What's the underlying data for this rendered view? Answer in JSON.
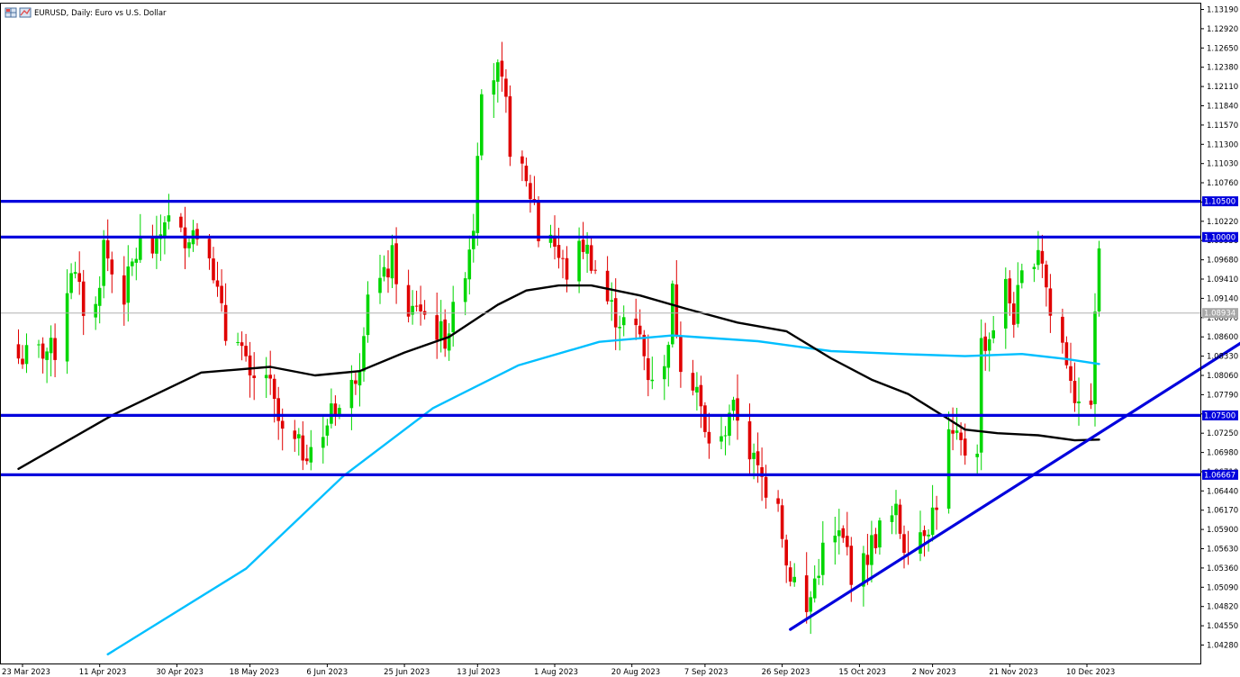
{
  "window": {
    "title": "EURUSD, Daily:  Euro vs U.S. Dollar",
    "icons": [
      "grid-icon",
      "chart-icon"
    ]
  },
  "chart_data": {
    "type": "candlestick",
    "symbol": "EURUSD",
    "timeframe": "Daily",
    "description": "Euro vs U.S. Dollar",
    "ylim": [
      1.0415,
      1.1325
    ],
    "y_ticks": [
      "1.13190",
      "1.12920",
      "1.12650",
      "1.12380",
      "1.12110",
      "1.11840",
      "1.11570",
      "1.11300",
      "1.11030",
      "1.10760",
      "1.10490",
      "1.10220",
      "1.09950",
      "1.09680",
      "1.09410",
      "1.09140",
      "1.08870",
      "1.08600",
      "1.08330",
      "1.08060",
      "1.07790",
      "1.07520",
      "1.07250",
      "1.06980",
      "1.06710",
      "1.06440",
      "1.06170",
      "1.05900",
      "1.05630",
      "1.05360",
      "1.05090",
      "1.04820",
      "1.04550",
      "1.04280"
    ],
    "x_ticks": [
      {
        "label": "23 Mar 2023",
        "date": "2023-03-23"
      },
      {
        "label": "11 Apr 2023",
        "date": "2023-04-11"
      },
      {
        "label": "30 Apr 2023",
        "date": "2023-04-30"
      },
      {
        "label": "18 May 2023",
        "date": "2023-05-18"
      },
      {
        "label": "6 Jun 2023",
        "date": "2023-06-06"
      },
      {
        "label": "25 Jun 2023",
        "date": "2023-06-25"
      },
      {
        "label": "13 Jul 2023",
        "date": "2023-07-13"
      },
      {
        "label": "1 Aug 2023",
        "date": "2023-08-01"
      },
      {
        "label": "20 Aug 2023",
        "date": "2023-08-20"
      },
      {
        "label": "7 Sep 2023",
        "date": "2023-09-07"
      },
      {
        "label": "26 Sep 2023",
        "date": "2023-09-26"
      },
      {
        "label": "15 Oct 2023",
        "date": "2023-10-15"
      },
      {
        "label": "2 Nov 2023",
        "date": "2023-11-02"
      },
      {
        "label": "21 Nov 2023",
        "date": "2023-11-21"
      },
      {
        "label": "10 Dec 2023",
        "date": "2023-12-10"
      }
    ],
    "date_range": [
      "2023-03-22",
      "2023-12-13"
    ],
    "close_path": [
      [
        "2023-03-22",
        1.083
      ],
      [
        "2023-03-28",
        1.084
      ],
      [
        "2023-03-31",
        1.084
      ],
      [
        "2023-04-04",
        1.096
      ],
      [
        "2023-04-07",
        1.09
      ],
      [
        "2023-04-10",
        1.09
      ],
      [
        "2023-04-12",
        1.099
      ],
      [
        "2023-04-14",
        1.095
      ],
      [
        "2023-04-17",
        1.092
      ],
      [
        "2023-04-19",
        1.096
      ],
      [
        "2023-04-21",
        1.099
      ],
      [
        "2023-04-25",
        1.098
      ],
      [
        "2023-04-27",
        1.103
      ],
      [
        "2023-05-01",
        1.1
      ],
      [
        "2023-05-04",
        1.101
      ],
      [
        "2023-05-08",
        1.099
      ],
      [
        "2023-05-10",
        1.092
      ],
      [
        "2023-05-12",
        1.086
      ],
      [
        "2023-05-15",
        1.087
      ],
      [
        "2023-05-18",
        1.079
      ],
      [
        "2023-05-22",
        1.081
      ],
      [
        "2023-05-24",
        1.076
      ],
      [
        "2023-05-26",
        1.072
      ],
      [
        "2023-05-31",
        1.07
      ],
      [
        "2023-06-02",
        1.071
      ],
      [
        "2023-06-05",
        1.071
      ],
      [
        "2023-06-07",
        1.077
      ],
      [
        "2023-06-09",
        1.076
      ],
      [
        "2023-06-12",
        1.079
      ],
      [
        "2023-06-14",
        1.083
      ],
      [
        "2023-06-16",
        1.093
      ],
      [
        "2023-06-20",
        1.094
      ],
      [
        "2023-06-22",
        1.097
      ],
      [
        "2023-06-26",
        1.088
      ],
      [
        "2023-06-28",
        1.091
      ],
      [
        "2023-07-01",
        1.088
      ],
      [
        "2023-07-05",
        1.086
      ],
      [
        "2023-07-07",
        1.089
      ],
      [
        "2023-07-10",
        1.096
      ],
      [
        "2023-07-12",
        1.102
      ],
      [
        "2023-07-13",
        1.113
      ],
      [
        "2023-07-14",
        1.122
      ],
      [
        "2023-07-18",
        1.123
      ],
      [
        "2023-07-20",
        1.118
      ],
      [
        "2023-07-21",
        1.113
      ],
      [
        "2023-07-25",
        1.107
      ],
      [
        "2023-07-27",
        1.105
      ],
      [
        "2023-07-28",
        1.1
      ],
      [
        "2023-07-31",
        1.101
      ],
      [
        "2023-08-02",
        1.097
      ],
      [
        "2023-08-04",
        1.095
      ],
      [
        "2023-08-08",
        1.099
      ],
      [
        "2023-08-10",
        1.097
      ],
      [
        "2023-08-14",
        1.091
      ],
      [
        "2023-08-16",
        1.089
      ],
      [
        "2023-08-18",
        1.088
      ],
      [
        "2023-08-22",
        1.086
      ],
      [
        "2023-08-24",
        1.081
      ],
      [
        "2023-08-28",
        1.081
      ],
      [
        "2023-08-30",
        1.092
      ],
      [
        "2023-09-01",
        1.083
      ],
      [
        "2023-09-05",
        1.079
      ],
      [
        "2023-09-07",
        1.072
      ],
      [
        "2023-09-11",
        1.071
      ],
      [
        "2023-09-13",
        1.076
      ],
      [
        "2023-09-15",
        1.075
      ],
      [
        "2023-09-18",
        1.07
      ],
      [
        "2023-09-20",
        1.067
      ],
      [
        "2023-09-22",
        1.065
      ],
      [
        "2023-09-25",
        1.064
      ],
      [
        "2023-09-27",
        1.054
      ],
      [
        "2023-09-29",
        1.052
      ],
      [
        "2023-10-02",
        1.047
      ],
      [
        "2023-10-04",
        1.052
      ],
      [
        "2023-10-06",
        1.056
      ],
      [
        "2023-10-10",
        1.058
      ],
      [
        "2023-10-12",
        1.056
      ],
      [
        "2023-10-13",
        1.053
      ],
      [
        "2023-10-16",
        1.054
      ],
      [
        "2023-10-18",
        1.057
      ],
      [
        "2023-10-20",
        1.059
      ],
      [
        "2023-10-24",
        1.061
      ],
      [
        "2023-10-26",
        1.057
      ],
      [
        "2023-10-30",
        1.059
      ],
      [
        "2023-11-01",
        1.06
      ],
      [
        "2023-11-03",
        1.063
      ],
      [
        "2023-11-06",
        1.072
      ],
      [
        "2023-11-08",
        1.071
      ],
      [
        "2023-11-10",
        1.07
      ],
      [
        "2023-11-13",
        1.071
      ],
      [
        "2023-11-14",
        1.085
      ],
      [
        "2023-11-16",
        1.086
      ],
      [
        "2023-11-20",
        1.093
      ],
      [
        "2023-11-22",
        1.089
      ],
      [
        "2023-11-24",
        1.094
      ],
      [
        "2023-11-28",
        1.099
      ],
      [
        "2023-11-29",
        1.097
      ],
      [
        "2023-12-01",
        1.089
      ],
      [
        "2023-12-04",
        1.085
      ],
      [
        "2023-12-06",
        1.081
      ],
      [
        "2023-12-08",
        1.075
      ],
      [
        "2023-12-10",
        1.076
      ],
      [
        "2023-12-11",
        1.078
      ],
      [
        "2023-12-12",
        1.088
      ],
      [
        "2023-12-13",
        1.099
      ]
    ],
    "current_price": {
      "label": "1.08934",
      "value": 1.08934
    },
    "horizontal_lines": [
      {
        "label": "1.10500",
        "value": 1.105
      },
      {
        "label": "1.10000",
        "value": 1.1
      },
      {
        "label": "1.07500",
        "value": 1.075
      },
      {
        "label": "1.06667",
        "value": 1.06667
      }
    ],
    "trendline": {
      "from": [
        "2023-09-28",
        1.045
      ],
      "to": [
        "2024-01-22",
        1.087
      ]
    },
    "moving_average_slow": {
      "color": "#00bfff",
      "points": [
        [
          "2023-04-13",
          1.0415
        ],
        [
          "2023-05-17",
          1.0535
        ],
        [
          "2023-06-10",
          1.0665
        ],
        [
          "2023-07-02",
          1.076
        ],
        [
          "2023-07-23",
          1.082
        ],
        [
          "2023-08-12",
          1.0853
        ],
        [
          "2023-08-30",
          1.0862
        ],
        [
          "2023-09-20",
          1.0854
        ],
        [
          "2023-10-08",
          1.084
        ],
        [
          "2023-10-25",
          1.0836
        ],
        [
          "2023-11-10",
          1.0833
        ],
        [
          "2023-11-24",
          1.0836
        ],
        [
          "2023-12-05",
          1.0829
        ],
        [
          "2023-12-13",
          1.0822
        ]
      ]
    },
    "moving_average_fast": {
      "color": "#000000",
      "points": [
        [
          "2023-03-22",
          1.0675
        ],
        [
          "2023-04-14",
          1.075
        ],
        [
          "2023-05-06",
          1.081
        ],
        [
          "2023-05-23",
          1.0818
        ],
        [
          "2023-06-03",
          1.0806
        ],
        [
          "2023-06-14",
          1.0812
        ],
        [
          "2023-06-25",
          1.0838
        ],
        [
          "2023-07-06",
          1.086
        ],
        [
          "2023-07-18",
          1.0905
        ],
        [
          "2023-07-25",
          1.0925
        ],
        [
          "2023-08-02",
          1.0932
        ],
        [
          "2023-08-10",
          1.0932
        ],
        [
          "2023-08-22",
          1.0918
        ],
        [
          "2023-09-02",
          1.09
        ],
        [
          "2023-09-15",
          1.088
        ],
        [
          "2023-09-27",
          1.0868
        ],
        [
          "2023-10-08",
          1.083
        ],
        [
          "2023-10-18",
          1.08
        ],
        [
          "2023-10-27",
          1.078
        ],
        [
          "2023-11-05",
          1.0748
        ],
        [
          "2023-11-10",
          1.073
        ],
        [
          "2023-11-18",
          1.0725
        ],
        [
          "2023-11-28",
          1.0722
        ],
        [
          "2023-12-07",
          1.0715
        ],
        [
          "2023-12-13",
          1.0716
        ]
      ]
    },
    "colors": {
      "bull": "#00d600",
      "bear": "#e00000",
      "levels": "#0000dd",
      "trendline": "#0000dd",
      "ma_slow": "#00bfff",
      "ma_fast": "#000000",
      "grid": "#000000",
      "price_line": "#b0b0b0"
    }
  }
}
